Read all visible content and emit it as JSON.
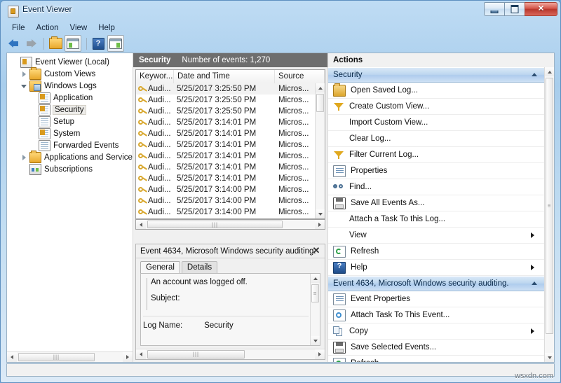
{
  "window": {
    "title": "Event Viewer",
    "icon": "event-viewer-icon",
    "buttons": {
      "minimize": "–",
      "maximize": "□",
      "close": "✕"
    }
  },
  "menubar": {
    "items": [
      "File",
      "Action",
      "View",
      "Help"
    ]
  },
  "toolbar": {
    "items": [
      {
        "name": "back-arrow-icon",
        "label": "Back"
      },
      {
        "name": "forward-arrow-icon",
        "label": "Forward"
      },
      {
        "name": "folder-icon",
        "label": "Up One Level"
      },
      {
        "name": "show-hide-console-tree-icon",
        "label": "Show/Hide Console Tree"
      },
      {
        "name": "help-icon",
        "label": "Help"
      },
      {
        "name": "show-hide-action-pane-icon",
        "label": "Show/Hide Action Pane"
      }
    ]
  },
  "tree": {
    "nodes": [
      {
        "label": "Event Viewer (Local)",
        "indent": 0,
        "expander": "none",
        "icon": "app-icon",
        "selected": false
      },
      {
        "label": "Custom Views",
        "indent": 1,
        "expander": "closed",
        "icon": "folder-icon",
        "selected": false
      },
      {
        "label": "Windows Logs",
        "indent": 1,
        "expander": "open",
        "icon": "log-folder-icon",
        "selected": false
      },
      {
        "label": "Application",
        "indent": 2,
        "expander": "none",
        "icon": "log-warn-icon",
        "selected": false
      },
      {
        "label": "Security",
        "indent": 2,
        "expander": "none",
        "icon": "log-warn-icon",
        "selected": true
      },
      {
        "label": "Setup",
        "indent": 2,
        "expander": "none",
        "icon": "log-icon",
        "selected": false
      },
      {
        "label": "System",
        "indent": 2,
        "expander": "none",
        "icon": "log-warn-icon",
        "selected": false
      },
      {
        "label": "Forwarded Events",
        "indent": 2,
        "expander": "none",
        "icon": "log-icon",
        "selected": false
      },
      {
        "label": "Applications and Services Lo",
        "indent": 1,
        "expander": "closed",
        "icon": "folder-icon",
        "selected": false
      },
      {
        "label": "Subscriptions",
        "indent": 1,
        "expander": "none",
        "icon": "subscriptions-icon",
        "selected": false
      }
    ]
  },
  "log": {
    "name": "Security",
    "count_label": "Number of events: 1,270",
    "columns": [
      "Keywor...",
      "Date and Time",
      "Source"
    ],
    "rows": [
      {
        "keywords": "Audi...",
        "datetime": "5/25/2017 3:25:50 PM",
        "source": "Micros...",
        "selected": true
      },
      {
        "keywords": "Audi...",
        "datetime": "5/25/2017 3:25:50 PM",
        "source": "Micros...",
        "selected": false
      },
      {
        "keywords": "Audi...",
        "datetime": "5/25/2017 3:25:50 PM",
        "source": "Micros...",
        "selected": false
      },
      {
        "keywords": "Audi...",
        "datetime": "5/25/2017 3:14:01 PM",
        "source": "Micros...",
        "selected": false
      },
      {
        "keywords": "Audi...",
        "datetime": "5/25/2017 3:14:01 PM",
        "source": "Micros...",
        "selected": false
      },
      {
        "keywords": "Audi...",
        "datetime": "5/25/2017 3:14:01 PM",
        "source": "Micros...",
        "selected": false
      },
      {
        "keywords": "Audi...",
        "datetime": "5/25/2017 3:14:01 PM",
        "source": "Micros...",
        "selected": false
      },
      {
        "keywords": "Audi...",
        "datetime": "5/25/2017 3:14:01 PM",
        "source": "Micros...",
        "selected": false
      },
      {
        "keywords": "Audi...",
        "datetime": "5/25/2017 3:14:01 PM",
        "source": "Micros...",
        "selected": false
      },
      {
        "keywords": "Audi...",
        "datetime": "5/25/2017 3:14:00 PM",
        "source": "Micros...",
        "selected": false
      },
      {
        "keywords": "Audi...",
        "datetime": "5/25/2017 3:14:00 PM",
        "source": "Micros...",
        "selected": false
      },
      {
        "keywords": "Audi...",
        "datetime": "5/25/2017 3:14:00 PM",
        "source": "Micros...",
        "selected": false
      }
    ]
  },
  "detail": {
    "title": "Event 4634, Microsoft Windows security auditing.",
    "close": "✕",
    "tabs": [
      {
        "label": "General",
        "active": true
      },
      {
        "label": "Details",
        "active": false
      }
    ],
    "body": {
      "line1": "An account was logged off.",
      "line2": "Subject:",
      "log_name_key": "Log Name:",
      "log_name_value": "Security"
    }
  },
  "actions": {
    "header": "Actions",
    "groups": [
      {
        "title": "Security",
        "items": [
          {
            "label": "Open Saved Log...",
            "icon": "open-log-icon",
            "submenu": false
          },
          {
            "label": "Create Custom View...",
            "icon": "filter-icon",
            "submenu": false
          },
          {
            "label": "Import Custom View...",
            "icon": "none",
            "submenu": false
          },
          {
            "label": "Clear Log...",
            "icon": "none",
            "submenu": false
          },
          {
            "label": "Filter Current Log...",
            "icon": "filter-icon",
            "submenu": false
          },
          {
            "label": "Properties",
            "icon": "properties-icon",
            "submenu": false
          },
          {
            "label": "Find...",
            "icon": "find-icon",
            "submenu": false
          },
          {
            "label": "Save All Events As...",
            "icon": "save-icon",
            "submenu": false
          },
          {
            "label": "Attach a Task To this Log...",
            "icon": "none",
            "submenu": false
          },
          {
            "label": "View",
            "icon": "none",
            "submenu": true
          },
          {
            "label": "Refresh",
            "icon": "refresh-icon",
            "submenu": false
          },
          {
            "label": "Help",
            "icon": "help-icon",
            "submenu": true
          }
        ]
      },
      {
        "title": "Event 4634, Microsoft Windows security auditing.",
        "items": [
          {
            "label": "Event Properties",
            "icon": "properties-icon",
            "submenu": false
          },
          {
            "label": "Attach Task To This Event...",
            "icon": "task-icon",
            "submenu": false
          },
          {
            "label": "Copy",
            "icon": "copy-icon",
            "submenu": true
          },
          {
            "label": "Save Selected Events...",
            "icon": "save-icon",
            "submenu": false
          },
          {
            "label": "Refresh",
            "icon": "refresh-icon",
            "submenu": false
          }
        ]
      }
    ]
  },
  "watermark": "wsxdn.com"
}
